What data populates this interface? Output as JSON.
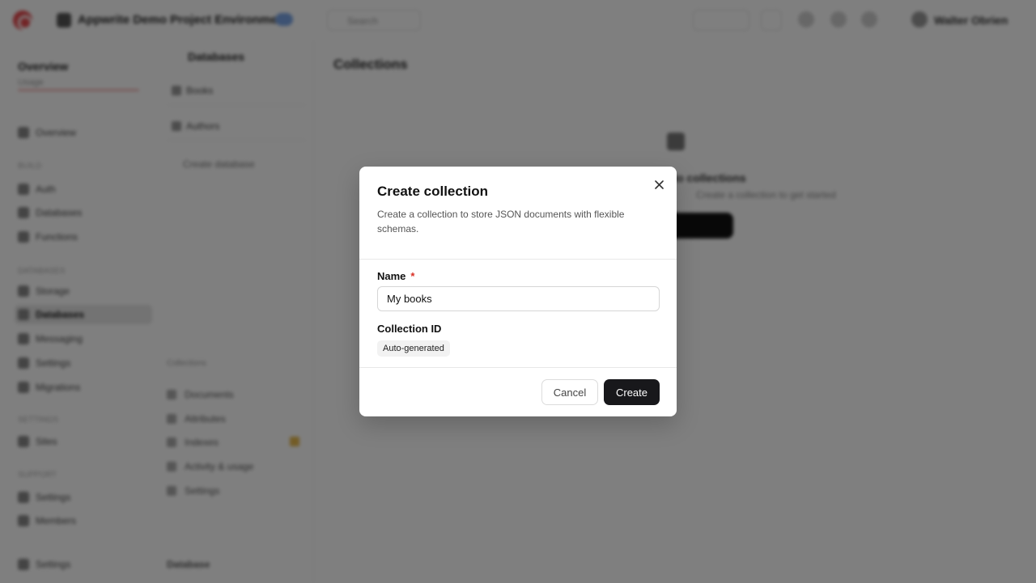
{
  "background": {
    "topbar": {
      "project_name": "Appwrite Demo Project Environment",
      "search_label": "Search",
      "user_name": "Walter Obrien"
    },
    "sidebar": {
      "org_title": "Overview",
      "org_sub": "Usage",
      "sections": [
        {
          "label": "Build"
        },
        {
          "label": "Databases"
        },
        {
          "label": "Settings"
        },
        {
          "label": "Support"
        }
      ],
      "items": [
        {
          "label": "Overview"
        },
        {
          "label": "Auth"
        },
        {
          "label": "Databases"
        },
        {
          "label": "Functions"
        },
        {
          "label": "Storage"
        },
        {
          "label": "Databases"
        },
        {
          "label": "Messaging"
        },
        {
          "label": "Settings"
        },
        {
          "label": "Migrations"
        },
        {
          "label": "Sites"
        },
        {
          "label": "Settings"
        },
        {
          "label": "Members"
        },
        {
          "label": "Settings"
        }
      ]
    },
    "panel": {
      "head": "Databases",
      "rows": [
        {
          "label": "Books"
        },
        {
          "label": "Authors"
        }
      ],
      "add_label": "Create database",
      "lower_section": "Collections",
      "lower_items": [
        {
          "label": "Documents"
        },
        {
          "label": "Attributes"
        },
        {
          "label": "Indexes"
        },
        {
          "label": "Activity & usage"
        },
        {
          "label": "Settings"
        }
      ],
      "bottom_label": "Database"
    },
    "main": {
      "title": "Collections",
      "empty_title": "No collections",
      "empty_sub": "Create a collection to get started"
    }
  },
  "modal": {
    "title": "Create collection",
    "description": "Create a collection to store JSON documents with flexible schemas.",
    "name_label": "Name",
    "required_mark": "*",
    "name_value": "My books",
    "id_label": "Collection ID",
    "id_badge": "Auto-generated",
    "cancel_label": "Cancel",
    "create_label": "Create"
  },
  "colors": {
    "overlay": "rgba(0,0,0,0.5)",
    "primary_button": "#18181b",
    "required": "#d93025"
  }
}
